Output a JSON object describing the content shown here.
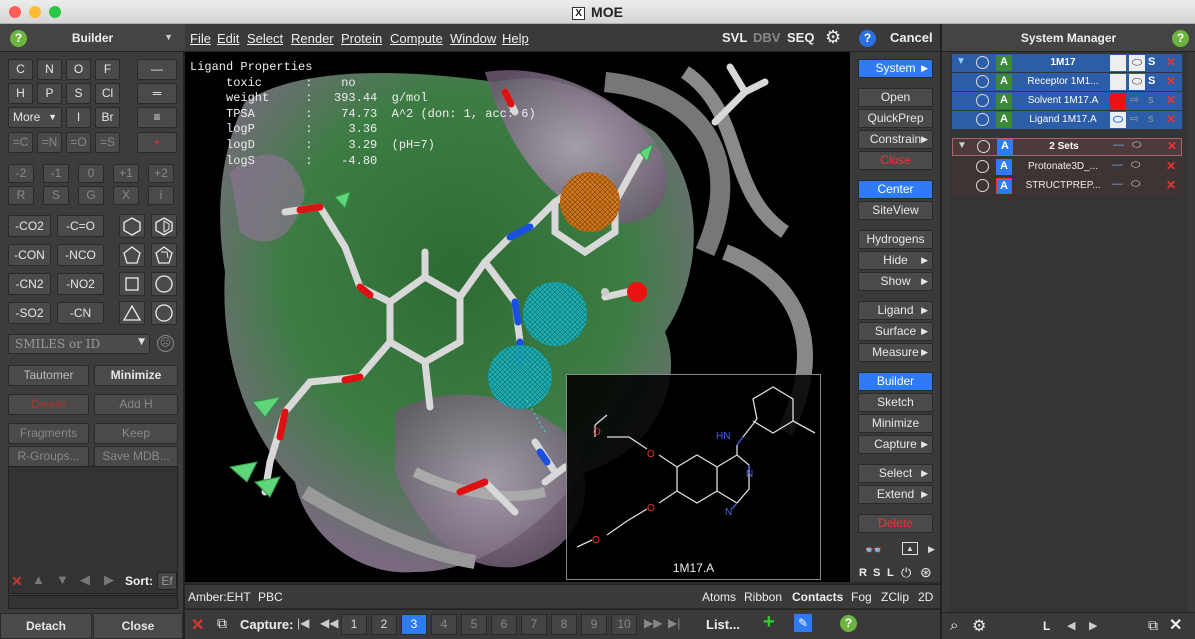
{
  "window": {
    "title": "MOE"
  },
  "builder": {
    "title": "Builder",
    "help": "?",
    "elements_row1": [
      "C",
      "N",
      "O",
      "F"
    ],
    "elements_row2": [
      "H",
      "P",
      "S",
      "Cl"
    ],
    "more": "More",
    "elements_row3": [
      "I",
      "Br"
    ],
    "bond_row": [
      "=C",
      "=N",
      "=O",
      "=S"
    ],
    "charges": [
      "-2",
      "-1",
      "0",
      "+1",
      "+2"
    ],
    "chirality": [
      "R",
      "S",
      "G",
      "X",
      "i"
    ],
    "groups": [
      "-CO2",
      "-C=O",
      "-CON",
      "-NCO",
      "-CN2",
      "-NO2",
      "-SO2",
      "-CN"
    ],
    "smiles_placeholder": "SMILES or ID",
    "tautomer": "Tautomer",
    "minimize": "Minimize",
    "delete": "Delete",
    "add_h": "Add H",
    "fragments": "Fragments",
    "keep": "Keep",
    "rgroups": "R-Groups...",
    "save_mdb": "Save MDB...",
    "sort": "Sort:",
    "sort_val": "Ef",
    "detach": "Detach",
    "close": "Close"
  },
  "menu": {
    "items": [
      "File",
      "Edit",
      "Select",
      "Render",
      "Protein",
      "Compute",
      "Window",
      "Help"
    ],
    "svl": "SVL",
    "dbv": "DBV",
    "seq": "SEQ",
    "help": "?",
    "cancel": "Cancel"
  },
  "ligand_properties": {
    "title": "Ligand Properties",
    "toxic": "no",
    "weight": "393.44",
    "weight_unit": "g/mol",
    "tpsa": "74.73",
    "tpsa_unit": "A^2 (don: 1, acc: 6)",
    "logp": "3.36",
    "logd": "3.29",
    "logd_note": "(pH=7)",
    "logs": "-4.80"
  },
  "inset": {
    "label": "1M17.A"
  },
  "commands": {
    "system": "System",
    "open": "Open",
    "quickprep": "QuickPrep",
    "constrain": "Constrain",
    "close": "Close",
    "center": "Center",
    "siteview": "SiteView",
    "hydrogens": "Hydrogens",
    "hide": "Hide",
    "show": "Show",
    "ligand": "Ligand",
    "surface": "Surface",
    "measure": "Measure",
    "builder": "Builder",
    "sketch": "Sketch",
    "minimize": "Minimize",
    "capture": "Capture",
    "select": "Select",
    "extend": "Extend",
    "delete": "Delete",
    "letters": [
      "R",
      "S",
      "L"
    ]
  },
  "status_bar": {
    "amber": "Amber:EHT",
    "pbc": "PBC",
    "atoms": "Atoms",
    "ribbon": "Ribbon",
    "contacts": "Contacts",
    "fog": "Fog",
    "zclip": "ZClip",
    "twod": "2D"
  },
  "capture_bar": {
    "label": "Capture:",
    "pages": [
      "1",
      "2",
      "3",
      "4",
      "5",
      "6",
      "7",
      "8",
      "9",
      "10"
    ],
    "active": "3",
    "list": "List..."
  },
  "system_manager": {
    "title": "System Manager",
    "rows": [
      {
        "name": "1M17",
        "s": "S"
      },
      {
        "name": "Receptor 1M1...",
        "s": "S"
      },
      {
        "name": "Solvent 1M17.A",
        "s": "s"
      },
      {
        "name": "Ligand 1M17.A",
        "s": "s"
      }
    ],
    "sets_header": "2 Sets",
    "sets": [
      "Protonate3D_...",
      "STRUCTPREP..."
    ],
    "footer_letter": "L"
  },
  "colors": {
    "accent": "#2f7bf6",
    "delete": "#e33333",
    "help_green": "#6db33f"
  }
}
